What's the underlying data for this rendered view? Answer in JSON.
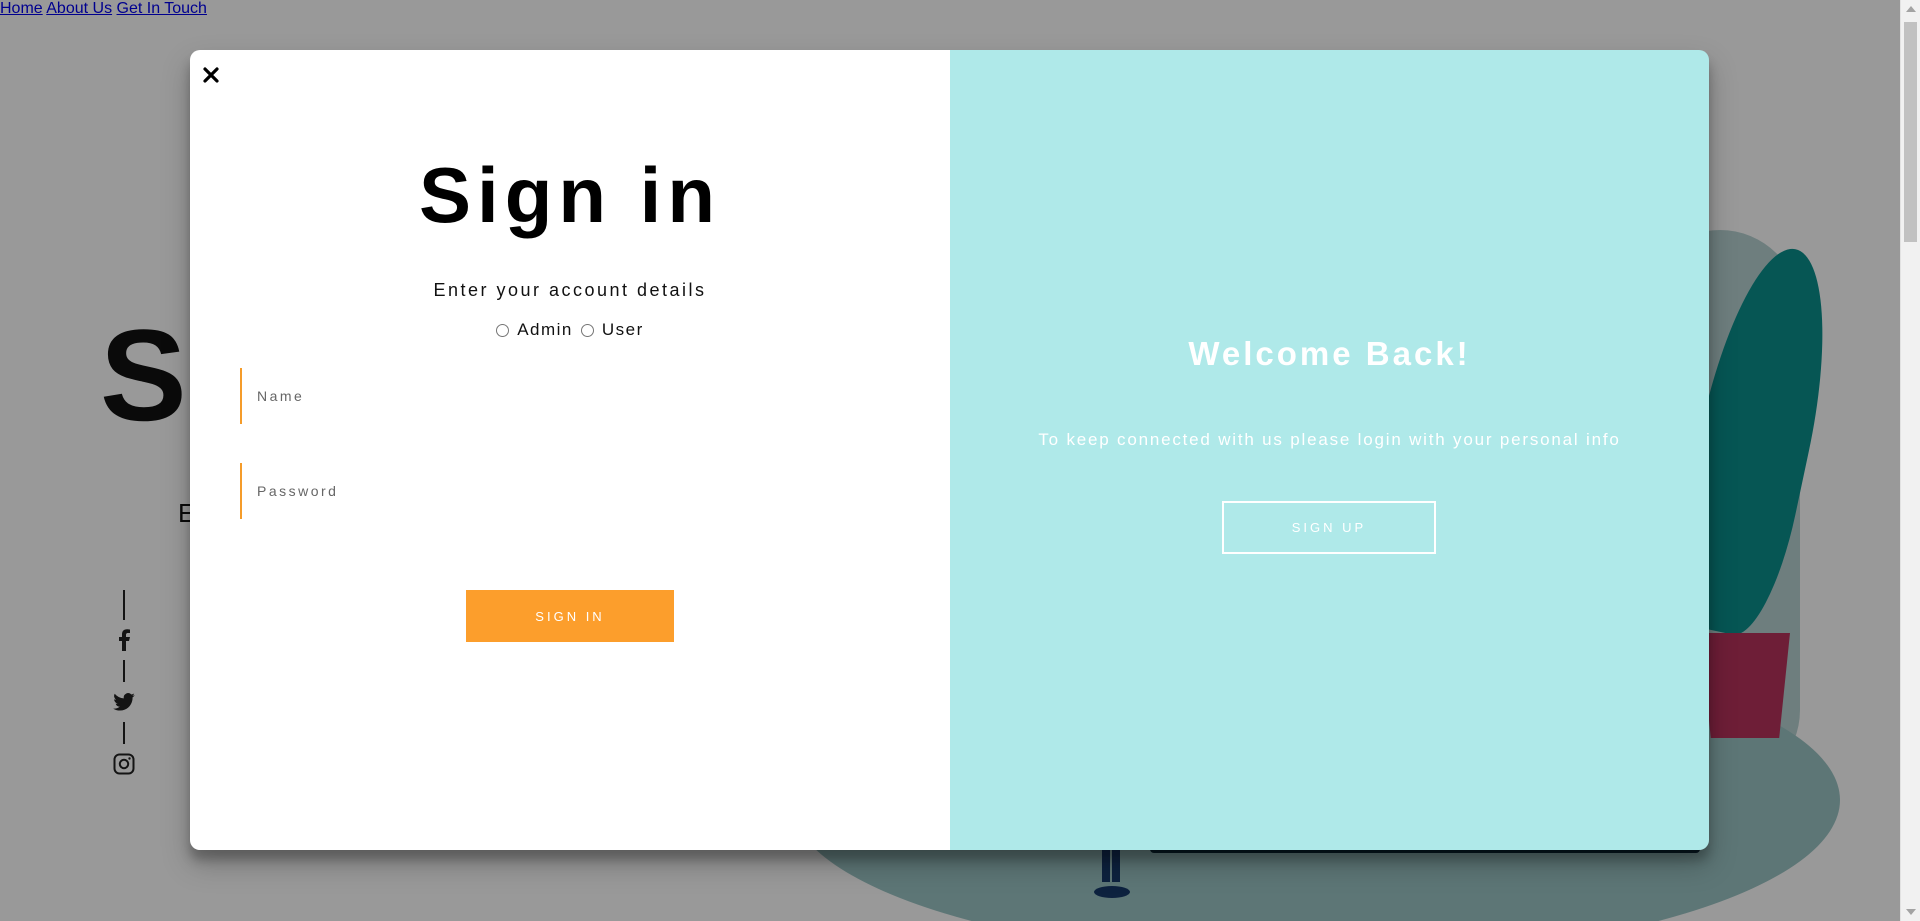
{
  "background": {
    "nav": [
      {
        "label": "Home"
      },
      {
        "label": "About Us"
      },
      {
        "label": "Get In Touch"
      }
    ],
    "hero_letter": "S",
    "hero_sub": "E",
    "social_icons": [
      "facebook-icon",
      "twitter-icon",
      "instagram-icon"
    ]
  },
  "modal": {
    "close_icon": "close-icon",
    "signin": {
      "title": "Sign in",
      "subtitle": "Enter your account details",
      "roles": [
        {
          "label": "Admin",
          "checked": false
        },
        {
          "label": "User",
          "checked": false
        }
      ],
      "name_placeholder": "Name",
      "password_placeholder": "Password",
      "button_label": "SIGN IN"
    },
    "welcome": {
      "title": "Welcome Back!",
      "subtitle": "To keep connected with us please login with your personal info",
      "button_label": "SIGN UP"
    }
  },
  "colors": {
    "accent_orange": "#fc9e2c",
    "panel_right": "#afe9e9",
    "overlay": "rgba(0,0,0,0.40)"
  }
}
